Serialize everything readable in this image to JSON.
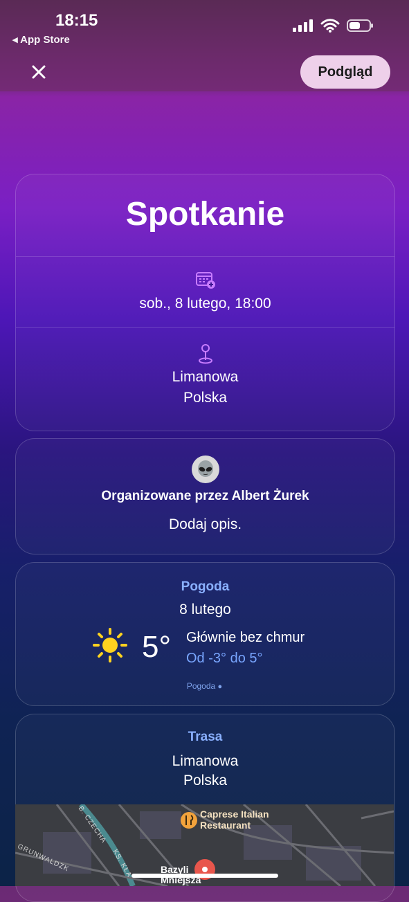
{
  "status_bar": {
    "time": "18:15",
    "back_app": "◂ App Store"
  },
  "nav": {
    "close_icon": "close-icon",
    "preview_label": "Podgląd"
  },
  "event": {
    "title": "Spotkanie",
    "date": "sob., 8 lutego, 18:00",
    "location_line1": "Limanowa",
    "location_line2": "Polska"
  },
  "organizer": {
    "text": "Organizowane przez Albert Żurek",
    "description_prompt": "Dodaj opis."
  },
  "weather": {
    "label": "Pogoda",
    "date": "8 lutego",
    "temperature": "5°",
    "condition": "Głównie bez chmur",
    "range": "Od -3° do 5°",
    "footer": "Pogoda"
  },
  "route": {
    "label": "Trasa",
    "line1": "Limanowa",
    "line2": "Polska",
    "map": {
      "poi1": "Caprese Italian Restaurant",
      "poi1_line1": "Caprese Italian",
      "poi1_line2": "Restaurant",
      "poi2": "Bazyli",
      "poi2b": "Mniejsza",
      "street1": "B. CZECHA",
      "street2": "GRUNWALDZK",
      "street3": "KS. KŁA"
    }
  },
  "colors": {
    "accent_blue": "#8ab0ff",
    "preview_bg": "#eed0ea"
  }
}
